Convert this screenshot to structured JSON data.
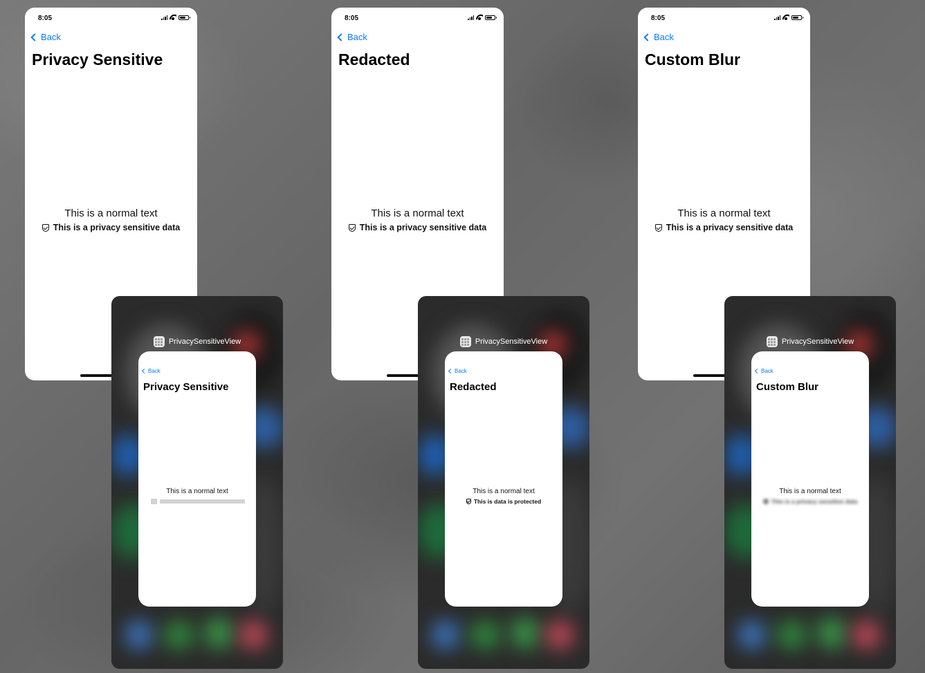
{
  "panels": [
    {
      "status_time": "8:05",
      "back_label": "Back",
      "title": "Privacy Sensitive",
      "normal_text": "This is a normal text",
      "sensitive_text": "This is a privacy sensitive data",
      "switcher": {
        "app_name": "PrivacySensitiveView",
        "back_label": "Back",
        "title": "Privacy Sensitive",
        "normal_text": "This is a normal text",
        "mode": "redacted-placeholder"
      }
    },
    {
      "status_time": "8:05",
      "back_label": "Back",
      "title": "Redacted",
      "normal_text": "This is a normal text",
      "sensitive_text": "This is a privacy sensitive data",
      "switcher": {
        "app_name": "PrivacySensitiveView",
        "back_label": "Back",
        "title": "Redacted",
        "normal_text": "This is a normal text",
        "protected_text": "This is data is protected",
        "mode": "replaced-text"
      }
    },
    {
      "status_time": "8:05",
      "back_label": "Back",
      "title": "Custom Blur",
      "normal_text": "This is a normal text",
      "sensitive_text": "This is a privacy sensitive data",
      "switcher": {
        "app_name": "PrivacySensitiveView",
        "back_label": "Back",
        "title": "Custom Blur",
        "normal_text": "This is a normal text",
        "blurred_text": "This is a privacy sensitive data",
        "mode": "blurred"
      }
    }
  ],
  "colors": {
    "accent": "#0a7aff",
    "placeholder_gray": "#d3d3d3"
  },
  "icons": {
    "back": "chevron-left-icon",
    "shield": "shield-check-icon",
    "app": "app-grid-icon"
  }
}
